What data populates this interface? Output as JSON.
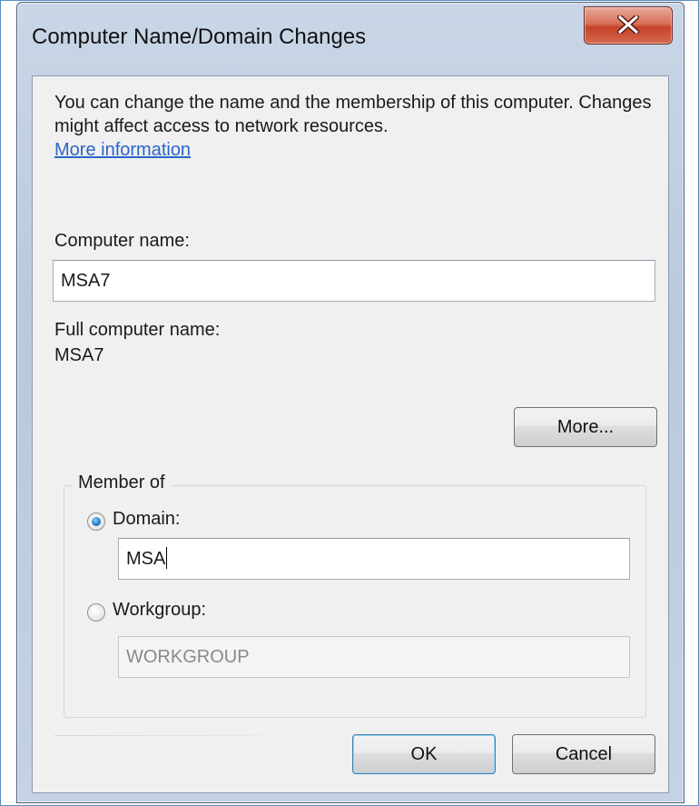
{
  "window": {
    "title": "Computer Name/Domain Changes",
    "close_icon": "close-icon"
  },
  "intro": {
    "text": "You can change the name and the membership of this computer. Changes might affect access to network resources.",
    "link": "More information"
  },
  "computer_name": {
    "label": "Computer name:",
    "value": "MSA7"
  },
  "full_computer_name": {
    "label": "Full computer name:",
    "value": "MSA7"
  },
  "more_button": {
    "label": "More..."
  },
  "member_of": {
    "title": "Member of",
    "domain": {
      "label": "Domain:",
      "value": "MSA",
      "selected": true
    },
    "workgroup": {
      "label": "Workgroup:",
      "value": "WORKGROUP",
      "selected": false
    }
  },
  "buttons": {
    "ok": "OK",
    "cancel": "Cancel"
  },
  "colors": {
    "link": "#2b66c9",
    "close_button": "#c7412a",
    "frame": "#b9c9de",
    "client": "#f0f0f0"
  }
}
